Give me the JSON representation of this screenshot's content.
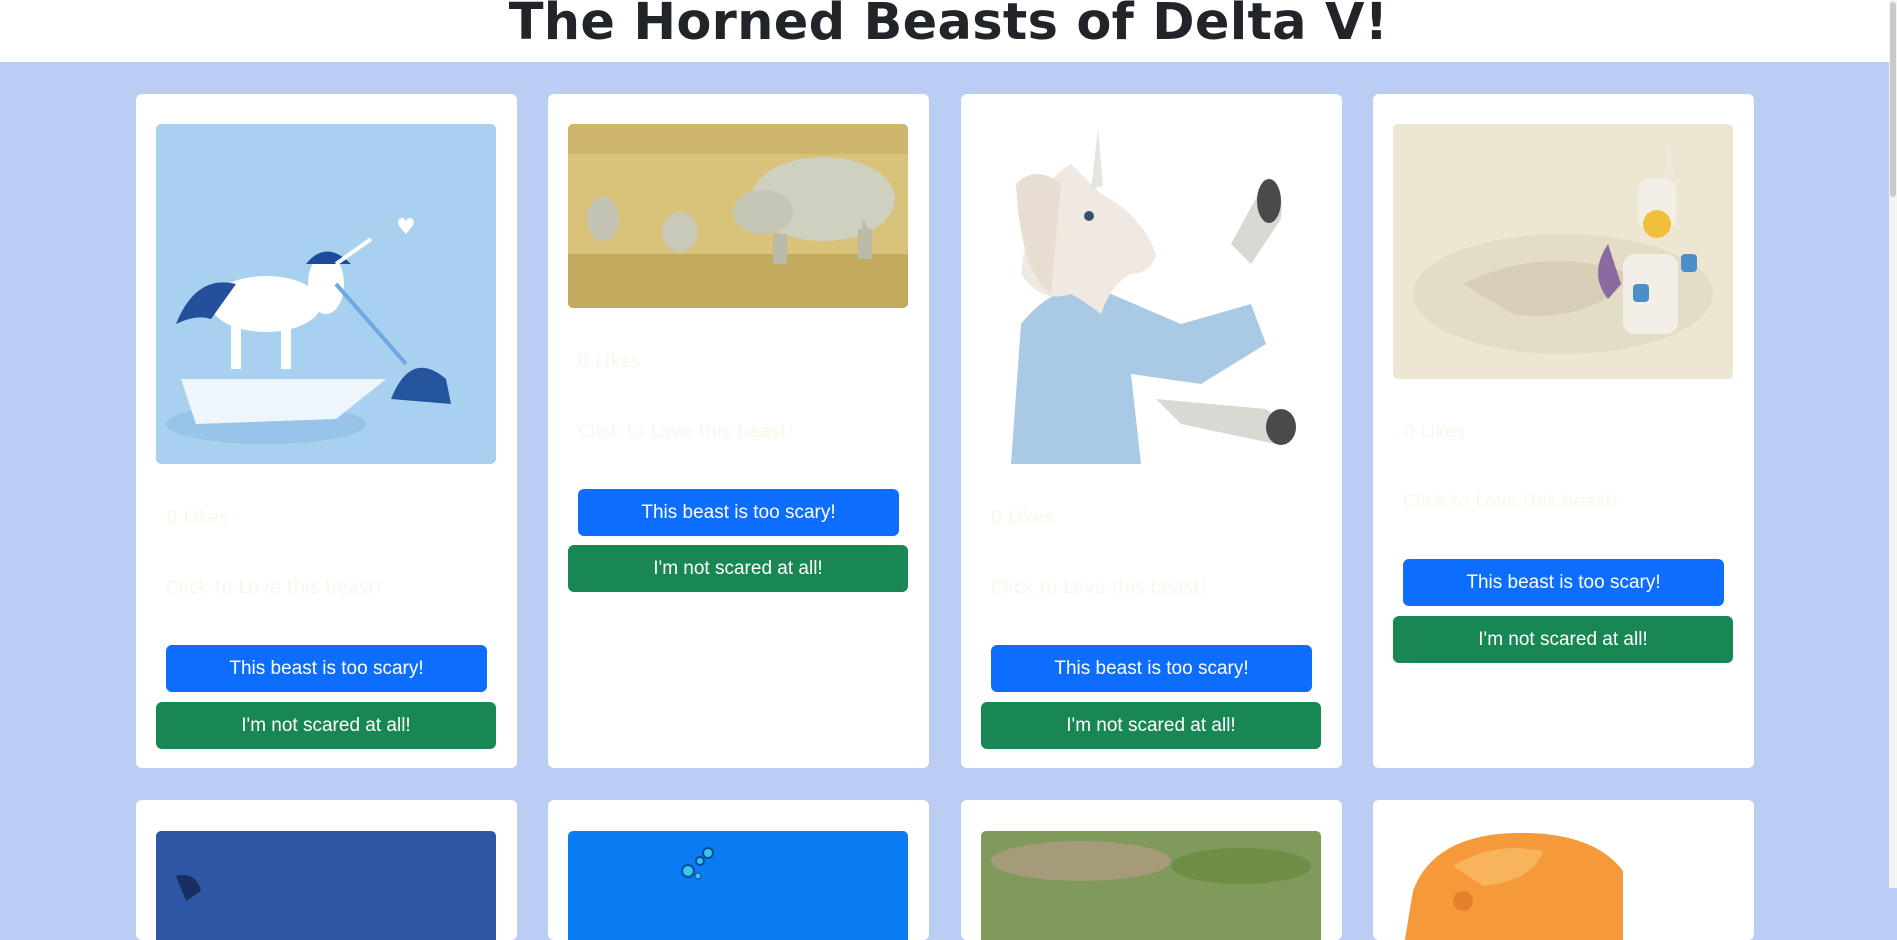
{
  "page": {
    "title": "The Horned Beasts of Delta V!",
    "colors": {
      "background": "#bccdf4",
      "primary": "#0d6efd",
      "success": "#198754"
    }
  },
  "beasts": [
    {
      "likes": "0 Likes",
      "prompt": "Click to Love this beast!",
      "scary_label": "This beast is too scary!",
      "brave_label": "I'm not scared at all!",
      "image": "unicorn-narwhal-illustration"
    },
    {
      "likes": "0 Likes",
      "prompt": "Click to Love this beast!",
      "scary_label": "This beast is too scary!",
      "brave_label": "I'm not scared at all!",
      "image": "rhino-family-photo"
    },
    {
      "likes": "0 Likes",
      "prompt": "Click to Love this beast!",
      "scary_label": "This beast is too scary!",
      "brave_label": "I'm not scared at all!",
      "image": "unicorn-mask-person-photo"
    },
    {
      "likes": "0 Likes",
      "prompt": "Click to Love this beast!",
      "scary_label": "This beast is too scary!",
      "brave_label": "I'm not scared at all!",
      "image": "lego-unicorn-photo"
    }
  ],
  "row2_images": [
    "narwhal-blue-image",
    "bubbles-blue-image",
    "grass-photo",
    "orange-triceratops-toy"
  ]
}
